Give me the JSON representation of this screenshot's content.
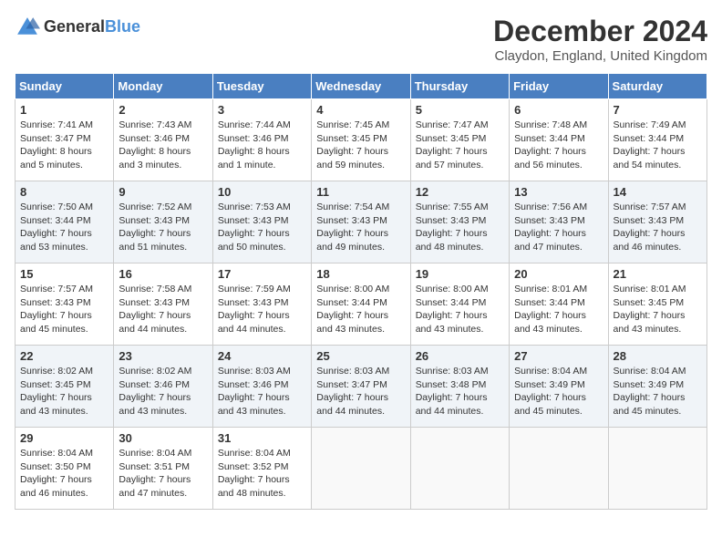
{
  "header": {
    "logo_general": "General",
    "logo_blue": "Blue",
    "title": "December 2024",
    "subtitle": "Claydon, England, United Kingdom"
  },
  "columns": [
    "Sunday",
    "Monday",
    "Tuesday",
    "Wednesday",
    "Thursday",
    "Friday",
    "Saturday"
  ],
  "weeks": [
    [
      {
        "day": "1",
        "sunrise": "Sunrise: 7:41 AM",
        "sunset": "Sunset: 3:47 PM",
        "daylight": "Daylight: 8 hours and 5 minutes."
      },
      {
        "day": "2",
        "sunrise": "Sunrise: 7:43 AM",
        "sunset": "Sunset: 3:46 PM",
        "daylight": "Daylight: 8 hours and 3 minutes."
      },
      {
        "day": "3",
        "sunrise": "Sunrise: 7:44 AM",
        "sunset": "Sunset: 3:46 PM",
        "daylight": "Daylight: 8 hours and 1 minute."
      },
      {
        "day": "4",
        "sunrise": "Sunrise: 7:45 AM",
        "sunset": "Sunset: 3:45 PM",
        "daylight": "Daylight: 7 hours and 59 minutes."
      },
      {
        "day": "5",
        "sunrise": "Sunrise: 7:47 AM",
        "sunset": "Sunset: 3:45 PM",
        "daylight": "Daylight: 7 hours and 57 minutes."
      },
      {
        "day": "6",
        "sunrise": "Sunrise: 7:48 AM",
        "sunset": "Sunset: 3:44 PM",
        "daylight": "Daylight: 7 hours and 56 minutes."
      },
      {
        "day": "7",
        "sunrise": "Sunrise: 7:49 AM",
        "sunset": "Sunset: 3:44 PM",
        "daylight": "Daylight: 7 hours and 54 minutes."
      }
    ],
    [
      {
        "day": "8",
        "sunrise": "Sunrise: 7:50 AM",
        "sunset": "Sunset: 3:44 PM",
        "daylight": "Daylight: 7 hours and 53 minutes."
      },
      {
        "day": "9",
        "sunrise": "Sunrise: 7:52 AM",
        "sunset": "Sunset: 3:43 PM",
        "daylight": "Daylight: 7 hours and 51 minutes."
      },
      {
        "day": "10",
        "sunrise": "Sunrise: 7:53 AM",
        "sunset": "Sunset: 3:43 PM",
        "daylight": "Daylight: 7 hours and 50 minutes."
      },
      {
        "day": "11",
        "sunrise": "Sunrise: 7:54 AM",
        "sunset": "Sunset: 3:43 PM",
        "daylight": "Daylight: 7 hours and 49 minutes."
      },
      {
        "day": "12",
        "sunrise": "Sunrise: 7:55 AM",
        "sunset": "Sunset: 3:43 PM",
        "daylight": "Daylight: 7 hours and 48 minutes."
      },
      {
        "day": "13",
        "sunrise": "Sunrise: 7:56 AM",
        "sunset": "Sunset: 3:43 PM",
        "daylight": "Daylight: 7 hours and 47 minutes."
      },
      {
        "day": "14",
        "sunrise": "Sunrise: 7:57 AM",
        "sunset": "Sunset: 3:43 PM",
        "daylight": "Daylight: 7 hours and 46 minutes."
      }
    ],
    [
      {
        "day": "15",
        "sunrise": "Sunrise: 7:57 AM",
        "sunset": "Sunset: 3:43 PM",
        "daylight": "Daylight: 7 hours and 45 minutes."
      },
      {
        "day": "16",
        "sunrise": "Sunrise: 7:58 AM",
        "sunset": "Sunset: 3:43 PM",
        "daylight": "Daylight: 7 hours and 44 minutes."
      },
      {
        "day": "17",
        "sunrise": "Sunrise: 7:59 AM",
        "sunset": "Sunset: 3:43 PM",
        "daylight": "Daylight: 7 hours and 44 minutes."
      },
      {
        "day": "18",
        "sunrise": "Sunrise: 8:00 AM",
        "sunset": "Sunset: 3:44 PM",
        "daylight": "Daylight: 7 hours and 43 minutes."
      },
      {
        "day": "19",
        "sunrise": "Sunrise: 8:00 AM",
        "sunset": "Sunset: 3:44 PM",
        "daylight": "Daylight: 7 hours and 43 minutes."
      },
      {
        "day": "20",
        "sunrise": "Sunrise: 8:01 AM",
        "sunset": "Sunset: 3:44 PM",
        "daylight": "Daylight: 7 hours and 43 minutes."
      },
      {
        "day": "21",
        "sunrise": "Sunrise: 8:01 AM",
        "sunset": "Sunset: 3:45 PM",
        "daylight": "Daylight: 7 hours and 43 minutes."
      }
    ],
    [
      {
        "day": "22",
        "sunrise": "Sunrise: 8:02 AM",
        "sunset": "Sunset: 3:45 PM",
        "daylight": "Daylight: 7 hours and 43 minutes."
      },
      {
        "day": "23",
        "sunrise": "Sunrise: 8:02 AM",
        "sunset": "Sunset: 3:46 PM",
        "daylight": "Daylight: 7 hours and 43 minutes."
      },
      {
        "day": "24",
        "sunrise": "Sunrise: 8:03 AM",
        "sunset": "Sunset: 3:46 PM",
        "daylight": "Daylight: 7 hours and 43 minutes."
      },
      {
        "day": "25",
        "sunrise": "Sunrise: 8:03 AM",
        "sunset": "Sunset: 3:47 PM",
        "daylight": "Daylight: 7 hours and 44 minutes."
      },
      {
        "day": "26",
        "sunrise": "Sunrise: 8:03 AM",
        "sunset": "Sunset: 3:48 PM",
        "daylight": "Daylight: 7 hours and 44 minutes."
      },
      {
        "day": "27",
        "sunrise": "Sunrise: 8:04 AM",
        "sunset": "Sunset: 3:49 PM",
        "daylight": "Daylight: 7 hours and 45 minutes."
      },
      {
        "day": "28",
        "sunrise": "Sunrise: 8:04 AM",
        "sunset": "Sunset: 3:49 PM",
        "daylight": "Daylight: 7 hours and 45 minutes."
      }
    ],
    [
      {
        "day": "29",
        "sunrise": "Sunrise: 8:04 AM",
        "sunset": "Sunset: 3:50 PM",
        "daylight": "Daylight: 7 hours and 46 minutes."
      },
      {
        "day": "30",
        "sunrise": "Sunrise: 8:04 AM",
        "sunset": "Sunset: 3:51 PM",
        "daylight": "Daylight: 7 hours and 47 minutes."
      },
      {
        "day": "31",
        "sunrise": "Sunrise: 8:04 AM",
        "sunset": "Sunset: 3:52 PM",
        "daylight": "Daylight: 7 hours and 48 minutes."
      },
      null,
      null,
      null,
      null
    ]
  ]
}
